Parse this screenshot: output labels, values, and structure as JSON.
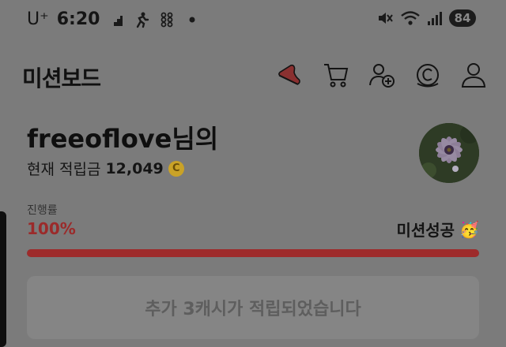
{
  "status_bar": {
    "carrier": "U⁺",
    "time": "6:20",
    "battery": "84"
  },
  "header": {
    "title": "미션보드",
    "icons": [
      "shoe-icon",
      "cart-icon",
      "add-friend-icon",
      "cash-icon",
      "profile-icon"
    ]
  },
  "user": {
    "name_line": "freeoflove님의",
    "points_label": "현재 적립금",
    "points_value": "12,049",
    "coin_symbol": "C"
  },
  "progress": {
    "label": "진행률",
    "value_text": "100%",
    "fraction": 1.0,
    "status": "미션성공",
    "status_emoji": "🥳"
  },
  "result": {
    "message": "추가 3캐시가 적립되었습니다"
  },
  "colors": {
    "accent": "#9e2b2b",
    "coin": "#c9a227",
    "overlay_bg": "#7b7b7b"
  }
}
